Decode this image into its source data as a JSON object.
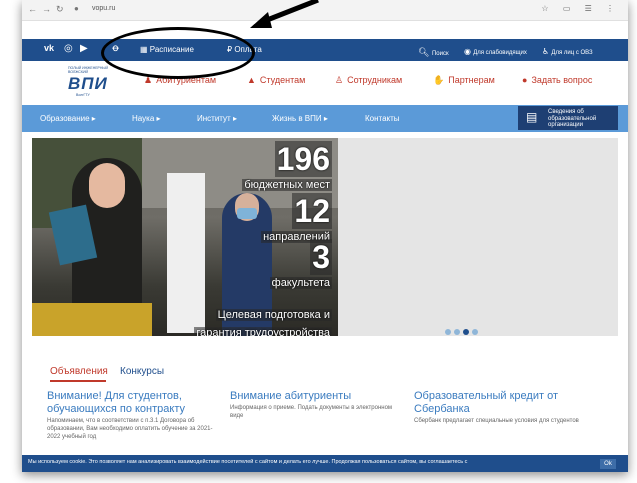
{
  "browser": {
    "url": "vopu.ru"
  },
  "topbar": {
    "schedule": "Расписание",
    "payment": "Оплата",
    "search": "Поиск",
    "low_vision": "Для слабовидящих",
    "ovz": "Для лиц с ОВЗ"
  },
  "logo": {
    "top": "ПОЛЫЙ ИНЖЕНЕРНЫЙ ВОЛЖСКИЙ",
    "main": "ВПИ",
    "tag": "ВолгГТУ"
  },
  "audience_menu": [
    {
      "label": "Абитуриентам"
    },
    {
      "label": "Студентам"
    },
    {
      "label": "Сотрудникам"
    },
    {
      "label": "Партнерам"
    },
    {
      "label": "Задать вопрос"
    }
  ],
  "main_nav": [
    {
      "label": "Образование ▸"
    },
    {
      "label": "Наука ▸"
    },
    {
      "label": "Институт ▸"
    },
    {
      "label": "Жизнь в ВПИ ▸"
    },
    {
      "label": "Контакты"
    }
  ],
  "info_button": "Сведения об образовательной организации",
  "hero": {
    "stat1_num": "196",
    "stat1_label": "бюджетных мест",
    "stat2_num": "12",
    "stat2_label": "направлений",
    "stat3_num": "3",
    "stat3_label": "факультета",
    "slogan1": "Целевая подготовка и",
    "slogan2": "гарантия трудоустройства"
  },
  "tabs": {
    "announcements": "Объявления",
    "contests": "Конкурсы"
  },
  "news": [
    {
      "title": "Внимание! Для студентов, обучающихся по контракту",
      "text": "Напоминаем, что в соответствии с п.3.1 Договора об образовании, Вам необходимо оплатить обучение за 2021-2022 учебный год"
    },
    {
      "title": "Внимание абитуриенты",
      "text": "Информация о приеме. Подать документы в электронном виде"
    },
    {
      "title": "Образовательный кредит от Сбербанка",
      "text": "Сбербанк предлагает специальные условия для студентов"
    }
  ],
  "cookie": {
    "text": "Мы используем cookie. Это позволяет нам анализировать взаимодействие посетителей с сайтом и делать его лучше. Продолжая пользоваться сайтом, вы соглашаетесь с",
    "ok": "Ok"
  }
}
